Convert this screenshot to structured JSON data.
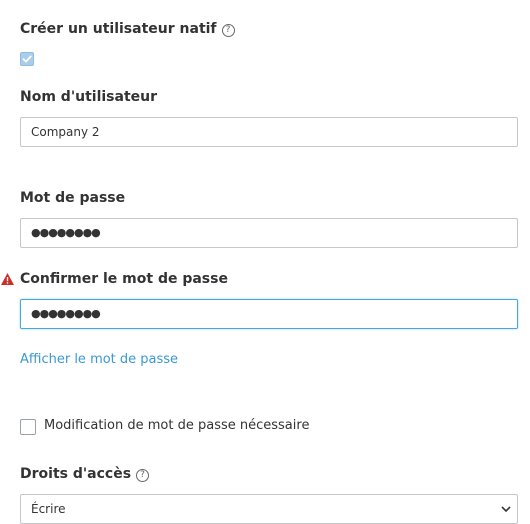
{
  "native_user": {
    "label": "Créer un utilisateur natif",
    "help_glyph": "?",
    "checked": true
  },
  "username": {
    "label": "Nom d'utilisateur",
    "value": "Company 2"
  },
  "password": {
    "label": "Mot de passe",
    "masked_value": "●●●●●●●●"
  },
  "confirm_password": {
    "label": "Confirmer le mot de passe",
    "masked_value": "●●●●●●●●",
    "warning_icon": "warning-triangle-icon",
    "warning_color": "#c9302c"
  },
  "show_password_link": "Afficher le mot de passe",
  "change_required": {
    "label": "Modification de mot de passe nécessaire",
    "checked": false
  },
  "access_rights": {
    "label": "Droits d'accès",
    "help_glyph": "?",
    "selected": "Écrire"
  },
  "colors": {
    "accent": "#3a98d1",
    "focus_border": "#4aa7d9",
    "checkbox_checked": "#a9cdea"
  }
}
